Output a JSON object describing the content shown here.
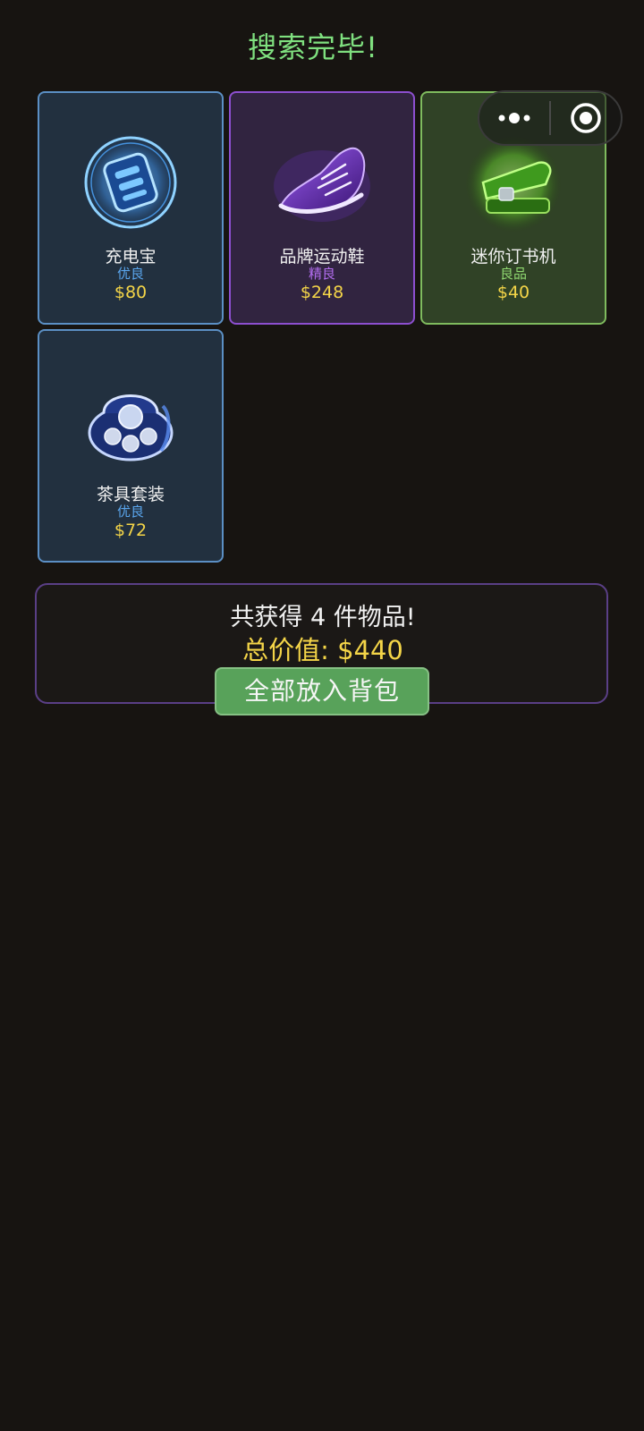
{
  "header": {
    "title": "搜索完毕!"
  },
  "capsule": {
    "more_icon": "more-dots-icon",
    "close_icon": "target-close-icon"
  },
  "items": [
    {
      "name": "充电宝",
      "rarity": "优良",
      "price": "$80",
      "tier": "blue",
      "icon": "power-bank-icon"
    },
    {
      "name": "品牌运动鞋",
      "rarity": "精良",
      "price": "$248",
      "tier": "purple",
      "icon": "sneaker-icon"
    },
    {
      "name": "迷你订书机",
      "rarity": "良品",
      "price": "$40",
      "tier": "green",
      "icon": "stapler-icon"
    },
    {
      "name": "茶具套装",
      "rarity": "优良",
      "price": "$72",
      "tier": "blue",
      "icon": "tea-set-icon"
    }
  ],
  "summary": {
    "count_text": "共获得 4 件物品!",
    "total_text": "总价值: $440",
    "button_label": "全部放入背包"
  },
  "colors": {
    "background": "#171411",
    "title": "#7fe07f",
    "price": "#f4d548",
    "blue_tier": "#5b8fc4",
    "purple_tier": "#8d4fd0",
    "green_tier": "#7fbb5e",
    "button": "#58a25a"
  }
}
